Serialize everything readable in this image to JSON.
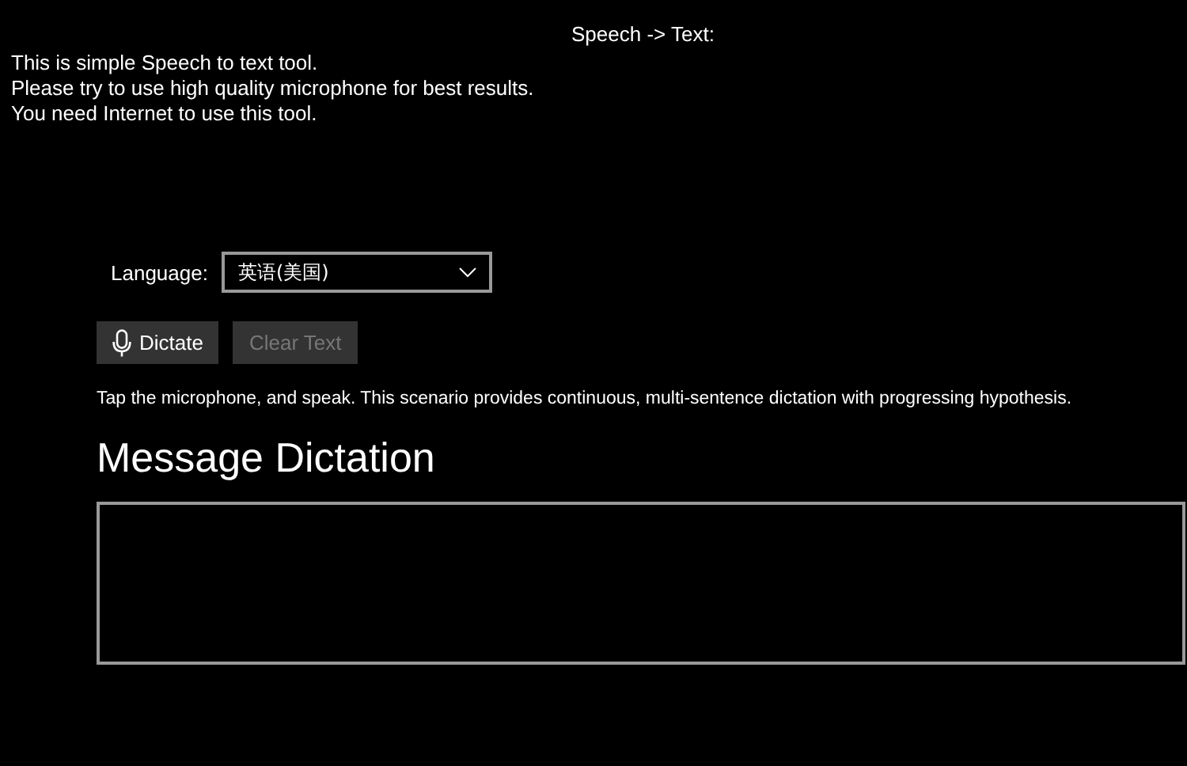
{
  "header": {
    "title": "Speech -> Text:"
  },
  "intro_lines": [
    "This is simple Speech to text tool.",
    "Please try to use high quality microphone for best results.",
    "You need Internet to use this tool."
  ],
  "language": {
    "label": "Language:",
    "value": "英语(美国)"
  },
  "buttons": [
    {
      "kind": "mic",
      "label": "Dictate",
      "disabled": false
    },
    {
      "kind": "plain",
      "label": "Clear Text",
      "disabled": true
    }
  ],
  "instructions": "Tap the microphone, and speak. This scenario provides continuous, multi-sentence dictation with progressing hypothesis.",
  "section_title": "Message Dictation"
}
